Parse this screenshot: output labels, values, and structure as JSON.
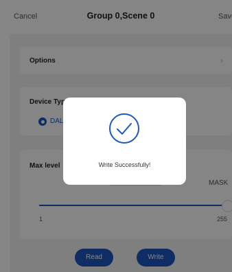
{
  "header": {
    "cancel_label": "Cancel",
    "title": "Group 0,Scene 0",
    "save_label": "Save"
  },
  "options": {
    "label": "Options",
    "icon": "chevron-right-icon"
  },
  "device_type": {
    "label": "Device Type",
    "selected_option": "DALI"
  },
  "max_level": {
    "label": "Max level",
    "value": "255",
    "mask_label": "MASK",
    "min_value": "1",
    "max_value": "255",
    "slider_level_fraction": 1.0
  },
  "actions": {
    "read_label": "Read",
    "write_label": "Write"
  },
  "dialog": {
    "message": "Write Successfully!",
    "icon": "check-circle-icon"
  },
  "colors": {
    "accent": "#1d57c0",
    "background": "#f4f4f4",
    "overlay": "rgba(0,0,0,0.48)"
  }
}
